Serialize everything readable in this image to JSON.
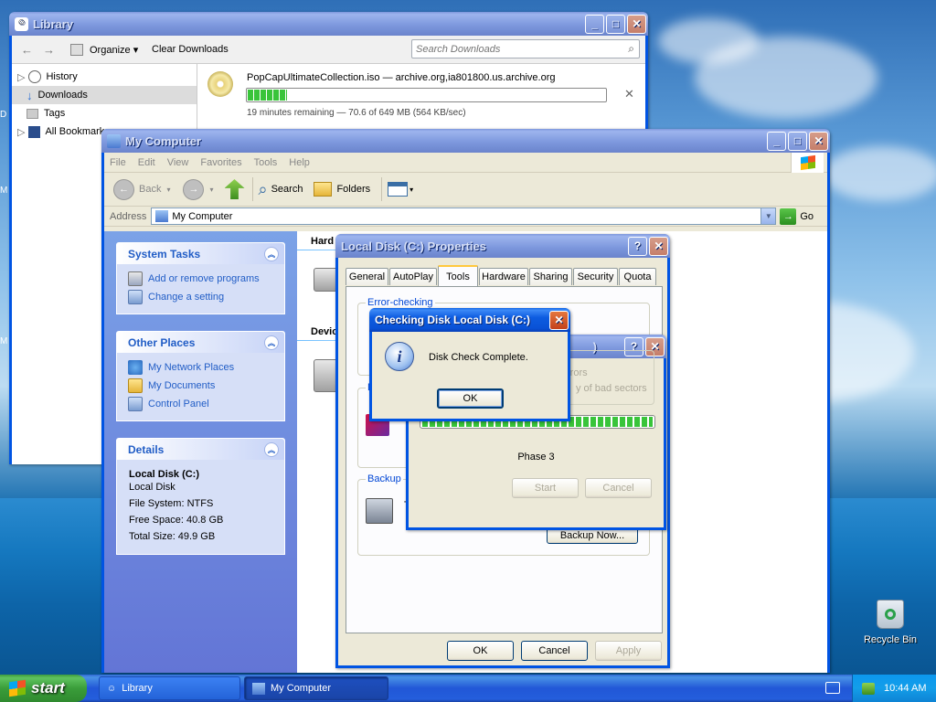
{
  "desktop": {
    "recycle_bin": "Recycle Bin",
    "edge_letters": [
      "D",
      "M",
      "M"
    ]
  },
  "library": {
    "title": "Library",
    "toolbar": {
      "organize": "Organize",
      "clear": "Clear Downloads",
      "search_placeholder": "Search Downloads"
    },
    "sidebar": [
      {
        "label": "History"
      },
      {
        "label": "Downloads"
      },
      {
        "label": "Tags"
      },
      {
        "label": "All Bookmarks"
      }
    ],
    "download": {
      "filename": "PopCapUltimateCollection.iso — archive.org,ia801800.us.archive.org",
      "status": "19 minutes remaining — 70.6 of 649 MB (564 KB/sec)",
      "progress": 0.109
    }
  },
  "mycomputer": {
    "title": "My Computer",
    "menu": [
      "File",
      "Edit",
      "View",
      "Favorites",
      "Tools",
      "Help"
    ],
    "toolbar": {
      "back": "Back",
      "search": "Search",
      "folders": "Folders"
    },
    "address": {
      "label": "Address",
      "value": "My Computer",
      "go": "Go"
    },
    "system_tasks": {
      "title": "System Tasks",
      "items": [
        "Add or remove programs",
        "Change a setting"
      ]
    },
    "other_places": {
      "title": "Other Places",
      "items": [
        "My Network Places",
        "My Documents",
        "Control Panel"
      ]
    },
    "details": {
      "title": "Details",
      "name": "Local Disk (C:)",
      "type": "Local Disk",
      "fs": "File System: NTFS",
      "free": "Free Space: 40.8 GB",
      "total": "Total Size: 49.9 GB"
    },
    "sections": {
      "hard": "Hard",
      "devices": "Devic"
    }
  },
  "properties": {
    "title": "Local Disk (C:) Properties",
    "tabs": [
      "General",
      "AutoPlay",
      "Tools",
      "Hardware",
      "Sharing",
      "Security",
      "Quota"
    ],
    "groups": {
      "error": "Error-checking",
      "defrag": "D",
      "backup": "Backup",
      "backup_text": "T"
    },
    "backup_button": "Backup Now...",
    "buttons": {
      "ok": "OK",
      "cancel": "Cancel",
      "apply": "Apply"
    }
  },
  "checkdisk": {
    "title_fragment": ")",
    "options": {
      "opt1": "rrors",
      "opt2": "y of bad sectors"
    },
    "progress": 1.0,
    "phase": "Phase 3",
    "start": "Start",
    "cancel": "Cancel"
  },
  "message": {
    "title": "Checking Disk Local Disk (C:)",
    "text": "Disk Check Complete.",
    "ok": "OK"
  },
  "taskbar": {
    "start": "start",
    "tasks": [
      "Library",
      "My Computer"
    ],
    "clock": "10:44 AM"
  }
}
